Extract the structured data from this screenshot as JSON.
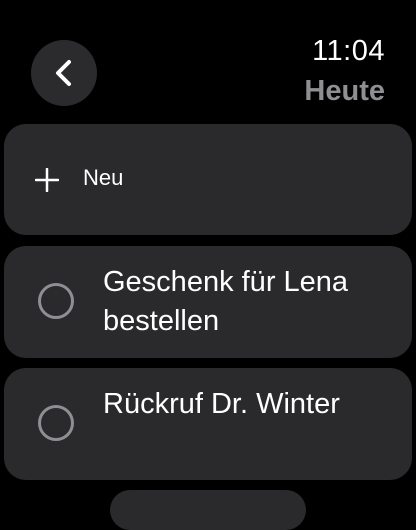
{
  "header": {
    "back_icon": "chevron-left-icon",
    "time": "11:04",
    "subtitle": "Heute"
  },
  "new_item": {
    "icon": "plus-icon",
    "label": "Neu"
  },
  "tasks": [
    {
      "title": "Geschenk für Lena bestellen",
      "completed": false
    },
    {
      "title": "Rückruf Dr. Winter",
      "completed": false
    }
  ],
  "colors": {
    "background": "#000000",
    "row_background": "#2a2a2c",
    "secondary_text": "#8e8e93"
  }
}
